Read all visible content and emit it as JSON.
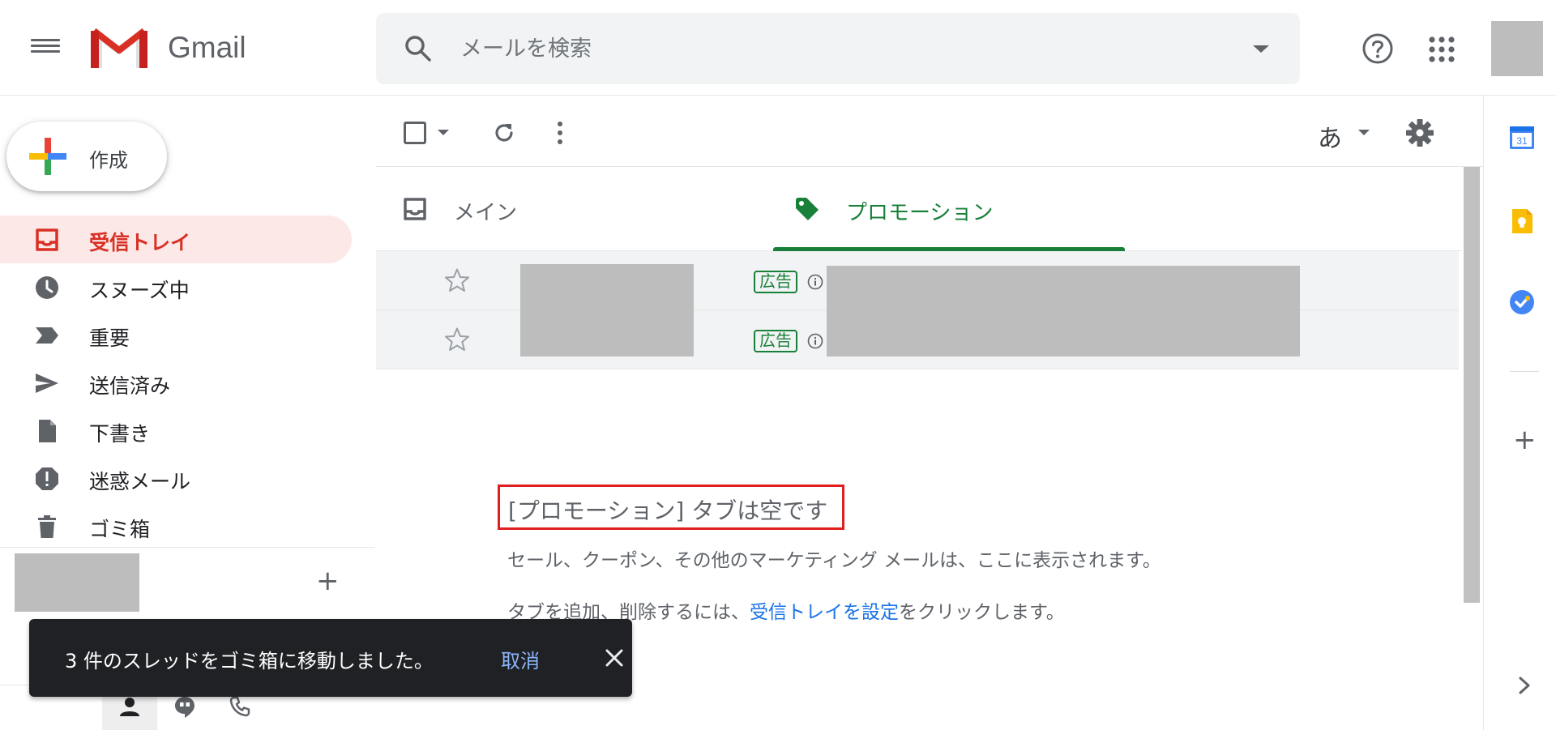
{
  "header": {
    "app_name": "Gmail",
    "search_placeholder": "メールを検索"
  },
  "compose": {
    "label": "作成"
  },
  "nav": {
    "items": [
      {
        "label": "受信トレイ",
        "icon": "inbox-icon",
        "active": true
      },
      {
        "label": "スヌーズ中",
        "icon": "clock-icon",
        "active": false
      },
      {
        "label": "重要",
        "icon": "important-icon",
        "active": false
      },
      {
        "label": "送信済み",
        "icon": "send-icon",
        "active": false
      },
      {
        "label": "下書き",
        "icon": "draft-icon",
        "active": false
      },
      {
        "label": "迷惑メール",
        "icon": "spam-icon",
        "active": false
      },
      {
        "label": "ゴミ箱",
        "icon": "trash-icon",
        "active": false
      }
    ]
  },
  "toolbar": {
    "input_tool": "あ"
  },
  "tabs": {
    "main": {
      "label": "メイン"
    },
    "promo": {
      "label": "プロモーション"
    }
  },
  "rows": [
    {
      "ad_label": "広告"
    },
    {
      "ad_label": "広告"
    }
  ],
  "empty_state": {
    "title": "[プロモーション] タブは空です",
    "description": "セール、クーポン、その他のマーケティング メールは、ここに表示されます。",
    "hint_before": "タブを追加、削除するには、",
    "hint_link": "受信トレイを設定",
    "hint_after": "をクリックします。"
  },
  "snackbar": {
    "message": "3 件のスレッドをゴミ箱に移動しました。",
    "undo": "取消"
  },
  "side_panel": {
    "calendar_day": "31"
  },
  "colors": {
    "active_red": "#d93025",
    "promo_green": "#188038",
    "link_blue": "#1a73e8"
  }
}
